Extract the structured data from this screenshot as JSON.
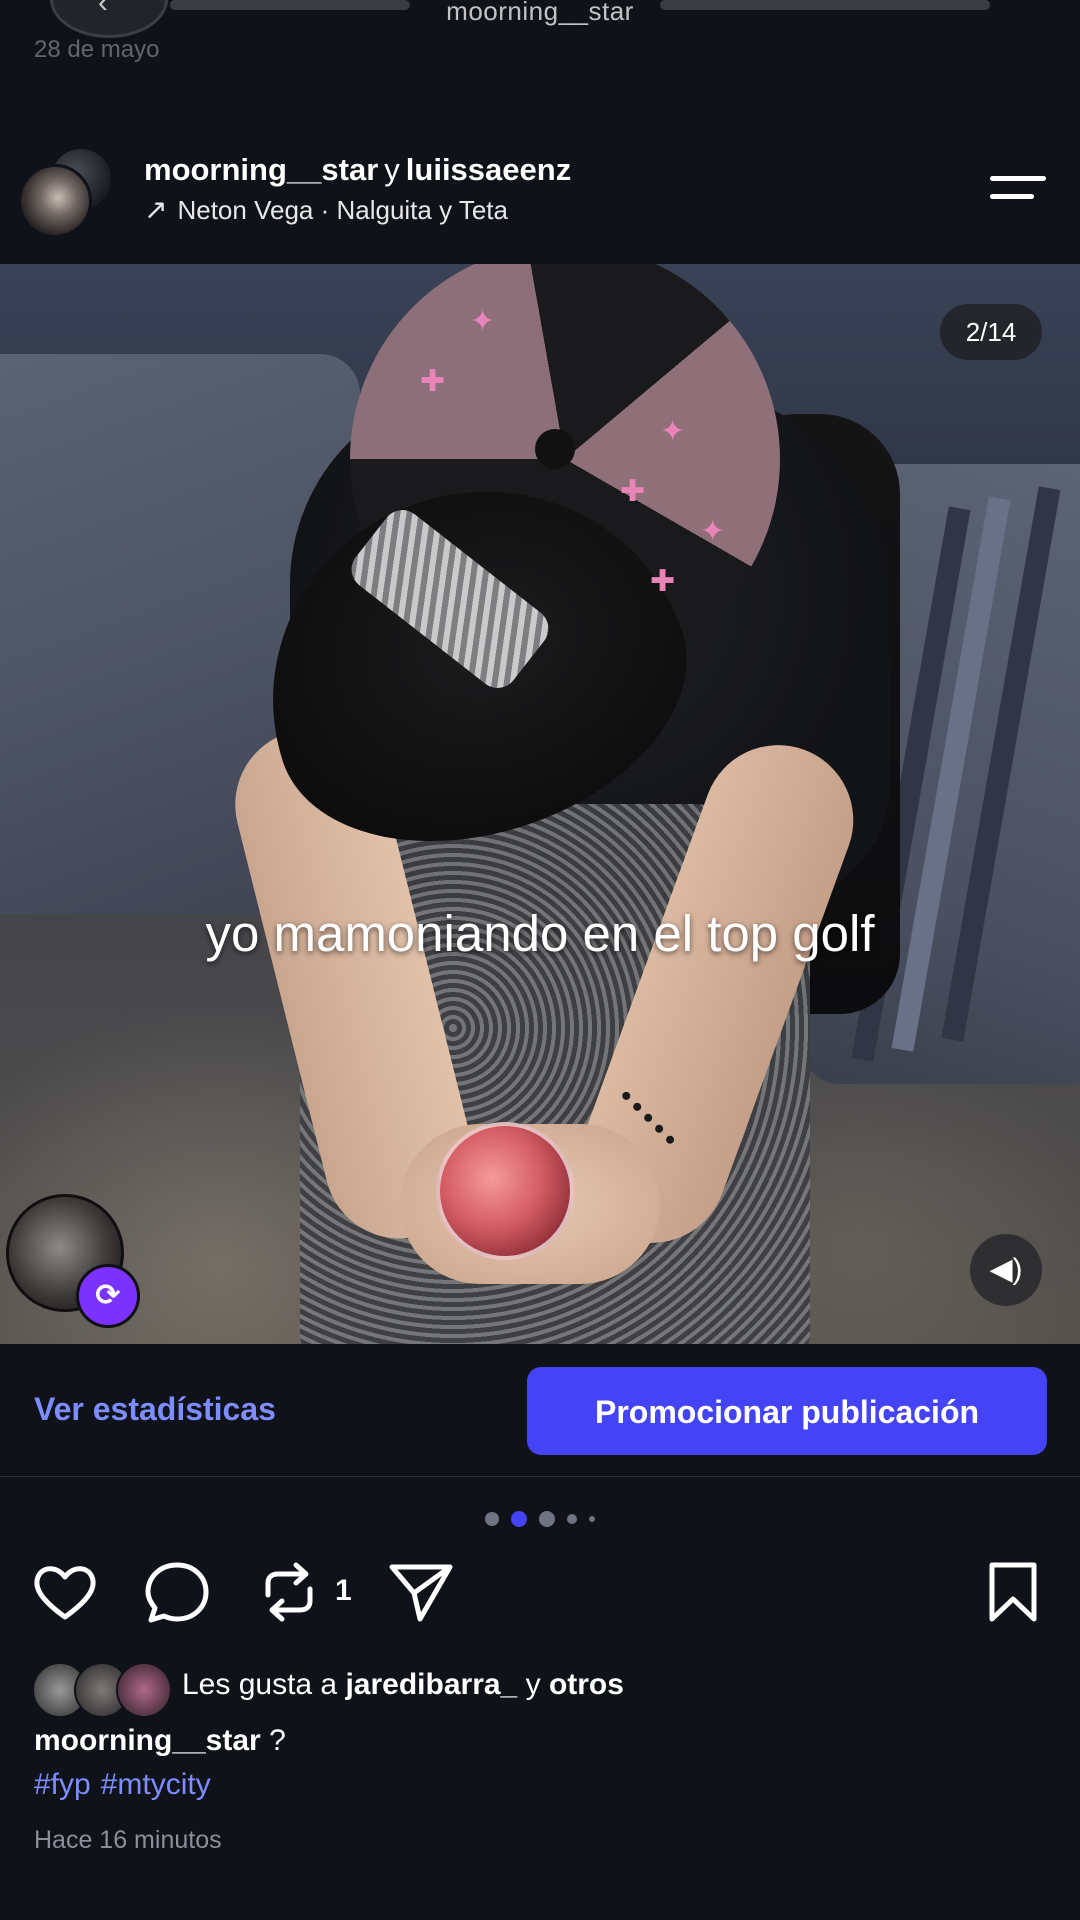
{
  "top_bar": {
    "title": "moorning__star",
    "date": "28 de mayo"
  },
  "post_header": {
    "user1": "moorning__star",
    "joiner": "y",
    "user2": "luiissaeenz",
    "sound_arrow": "↗",
    "sound": "Neton Vega · Nalguita y Teta"
  },
  "media": {
    "caption": "yo mamoniando en el top golf",
    "counter": "2/14",
    "carousel_total": 5,
    "carousel_active_index": 1
  },
  "actions": {
    "stats_label": "Ver estadísticas",
    "promote_label": "Promocionar publicación",
    "repost_count": "1"
  },
  "likes": {
    "prefix": "Les gusta a",
    "user": "jaredibarra_",
    "joiner": "y",
    "others": "otros"
  },
  "caption": {
    "user": "moorning__star",
    "text": "?",
    "hashtags": [
      "#fyp",
      "#mtycity"
    ]
  },
  "time_ago": "Hace 16 minutos",
  "colors": {
    "background": "#10121a",
    "accent": "#4443f5",
    "link": "#7d8dff",
    "repost_badge": "#7a33ff"
  },
  "icons": [
    "back-icon",
    "menu-icon",
    "repost-icon",
    "volume-icon",
    "heart-icon",
    "comment-icon",
    "send-icon",
    "bookmark-icon"
  ]
}
